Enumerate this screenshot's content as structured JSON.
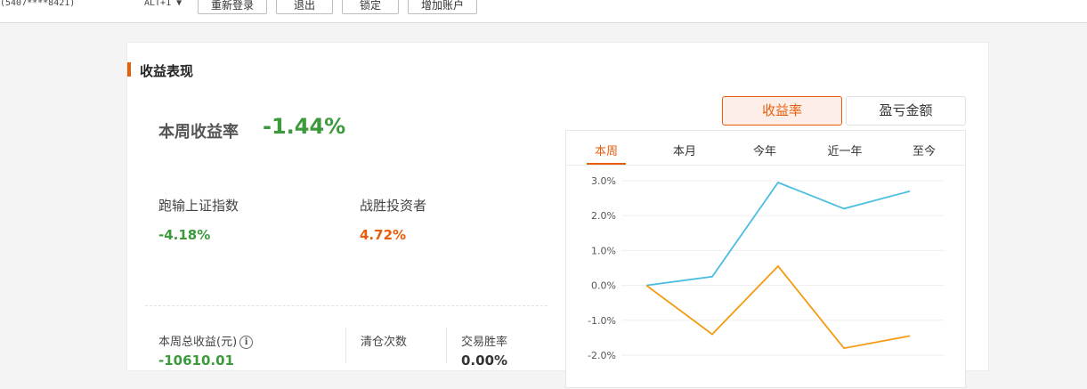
{
  "topbar": {
    "account": "(5407****8421)",
    "shortcut": "ALT+1 ▼",
    "buttons": [
      "重新登录",
      "退出",
      "锁定",
      "增加账户"
    ]
  },
  "section_title": "收益表现",
  "weekly": {
    "label": "本周收益率",
    "value": "-1.44%"
  },
  "metrics": [
    {
      "label": "跑输上证指数",
      "value": "-4.18%",
      "color": "#3c9a3c"
    },
    {
      "label": "战胜投资者",
      "value": "4.72%",
      "color": "#e85d0c"
    }
  ],
  "bottom": {
    "total_label": "本周总收益(元)",
    "total_value": "-10610.01",
    "clear_label": "清仓次数",
    "winrate_label": "交易胜率",
    "winrate_value": "0.00%"
  },
  "toggle": {
    "active": "收益率",
    "inactive": "盈亏金额"
  },
  "chart_tabs": [
    "本周",
    "本月",
    "今年",
    "近一年",
    "至今"
  ],
  "colors": {
    "accent": "#e85d0c",
    "positive": "#e85d0c",
    "negative": "#3c9a3c",
    "series_a": "#4bbde0",
    "series_b": "#f39c12"
  },
  "chart_data": {
    "type": "line",
    "ylim": [
      -2.0,
      3.0
    ],
    "y_ticks": [
      "3.0%",
      "2.0%",
      "1.0%",
      "0.0%",
      "-1.0%",
      "-2.0%"
    ],
    "y_tick_values": [
      3,
      2,
      1,
      0,
      -1,
      -2
    ],
    "x": [
      1,
      2,
      3,
      4,
      5
    ],
    "series": [
      {
        "values": [
          0.0,
          0.25,
          2.95,
          2.2,
          2.7
        ],
        "color": "#4bbde0"
      },
      {
        "values": [
          0.0,
          -1.4,
          0.55,
          -1.8,
          -1.45
        ],
        "color": "#f39c12"
      }
    ]
  }
}
